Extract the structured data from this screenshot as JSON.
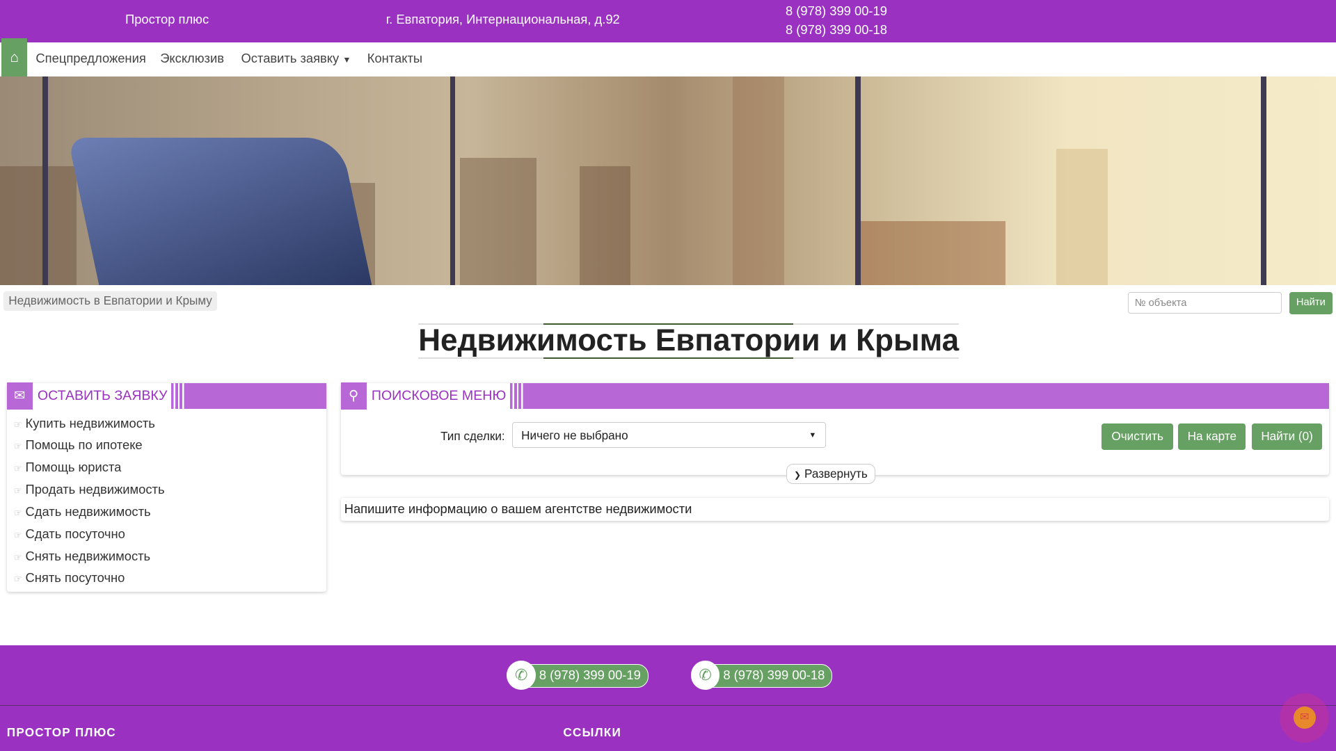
{
  "header": {
    "company": "Простор плюс",
    "address": "г. Евпатория, Интернациональная, д.92",
    "phones": [
      "8 (978) 399 00-19",
      "8 (978) 399 00-18"
    ]
  },
  "nav": {
    "items": [
      "Спецпредложения",
      "Эксклюзив",
      "Оставить заявку",
      "Контакты"
    ]
  },
  "breadcrumb": "Недвижимость в Евпатории и Крыму",
  "object_search": {
    "placeholder": "№ объекта",
    "button": "Найти"
  },
  "page_title": "Недвижимость Евпатории и Крыма",
  "request_panel": {
    "title": "ОСТАВИТЬ ЗАЯВКУ",
    "items": [
      "Купить недвижимость",
      "Помощь по ипотеке",
      "Помощь юриста",
      "Продать недвижимость",
      "Сдать недвижимость",
      "Сдать посуточно",
      "Снять недвижимость",
      "Снять посуточно"
    ]
  },
  "search_panel": {
    "title": "ПОИСКОВОЕ МЕНЮ",
    "deal_label": "Тип сделки:",
    "deal_value": "Ничего не выбрано",
    "clear": "Очистить",
    "map": "На карте",
    "find": "Найти (0)",
    "expand": "Развернуть"
  },
  "info_text": "Напишите информацию о вашем агентстве недвижимости",
  "footer": {
    "phones": [
      "8 (978) 399 00-19",
      "8 (978) 399 00-18"
    ],
    "col1": "ПРОСТОР ПЛЮС",
    "col2": "ССЫЛКИ"
  },
  "colors": {
    "brand": "#9a31c1",
    "accent": "#b867d7",
    "green": "#67a063"
  }
}
